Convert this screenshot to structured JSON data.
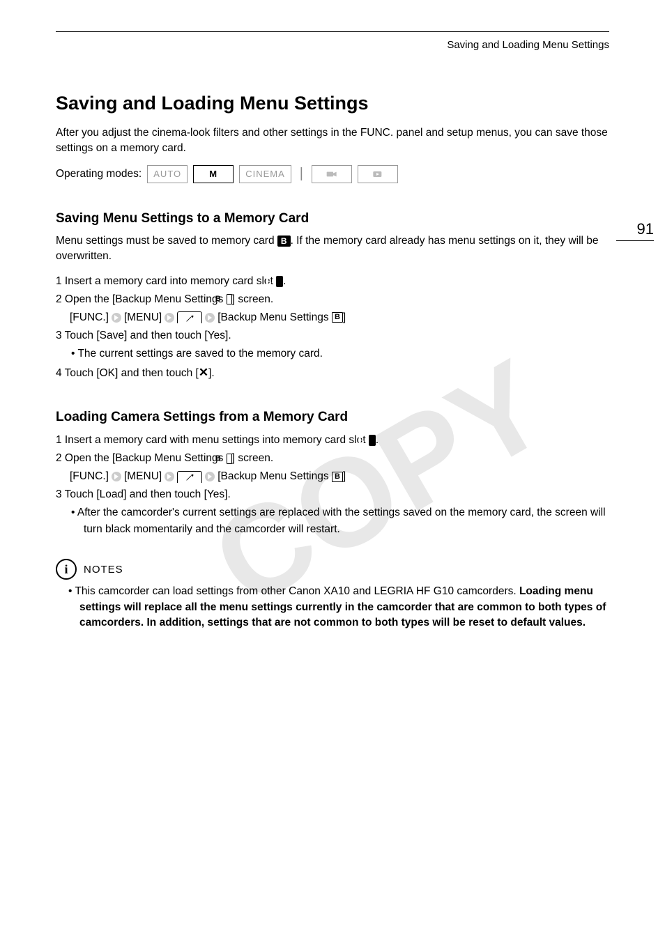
{
  "header": {
    "running_title": "Saving and Loading Menu Settings"
  },
  "page_number": "91",
  "title": "Saving and Loading Menu Settings",
  "intro": "After you adjust the cinema-look filters and other settings in the FUNC. panel and setup menus, you can save those settings on a memory card.",
  "modes": {
    "label": "Operating modes:",
    "auto": "AUTO",
    "m": "M",
    "cinema": "CINEMA"
  },
  "section1": {
    "heading": "Saving Menu Settings to a Memory Card",
    "intro_a": "Menu settings must be saved to memory card ",
    "intro_b": ". If the memory card already has menu settings on it, they will be overwritten.",
    "s1_a": "1  Insert a memory card into memory card slot ",
    "s1_b": ".",
    "s2_a": "2  Open the [Backup Menu Settings ",
    "s2_b": "] screen.",
    "path_func": "[FUNC.]",
    "path_menu": "[MENU]",
    "path_backup_a": "[Backup Menu Settings ",
    "path_backup_b": "]",
    "s3": "3  Touch [Save] and then touch [Yes].",
    "s3_sub": "•  The current settings are saved to the memory card.",
    "s4_a": "4  Touch [OK] and then touch [",
    "s4_b": "]."
  },
  "section2": {
    "heading": "Loading Camera Settings from a Memory Card",
    "s1_a": "1  Insert a memory card with menu settings into memory card slot ",
    "s1_b": ".",
    "s2_a": "2  Open the [Backup Menu Settings ",
    "s2_b": "] screen.",
    "s3": "3  Touch [Load] and then touch [Yes].",
    "s3_sub": "•  After the camcorder's current settings are replaced with the settings saved on the memory card, the screen will turn black momentarily and the camcorder will restart."
  },
  "notes": {
    "label": "NOTES",
    "n1_a": "•  This camcorder can load settings from other Canon XA10 and LEGRIA HF G10 camcorders. ",
    "n1_b": "Loading menu settings will replace all the menu settings currently in the camcorder that are common to both types of camcorders. In addition, settings that are not common to both types will be reset to default values."
  }
}
